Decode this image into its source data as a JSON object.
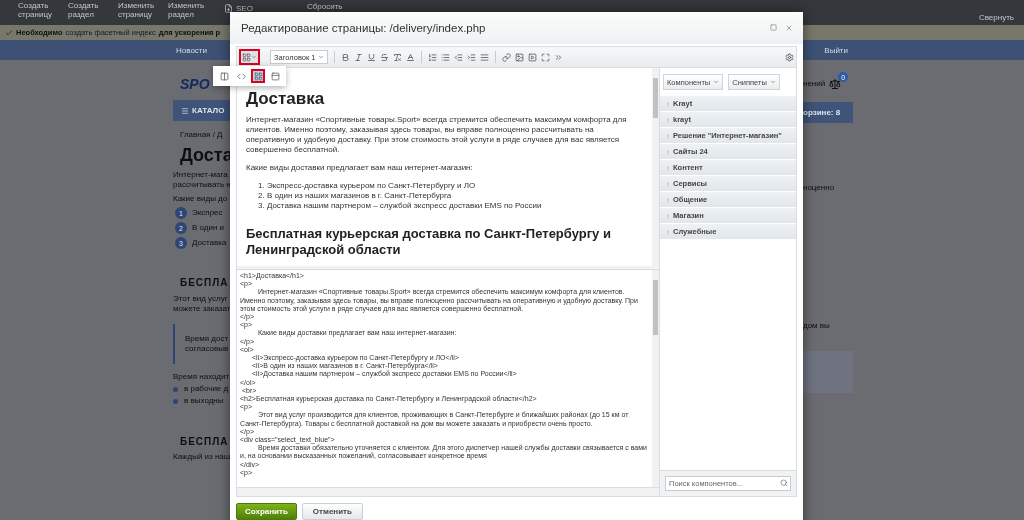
{
  "admin_bar": {
    "buttons": [
      "Создать страницу",
      "Создать раздел",
      "Изменить страницу",
      "Изменить раздел"
    ],
    "seo": "SEO",
    "reset": "Сбросить",
    "collapse": "Свернуть"
  },
  "notice": {
    "label": "Необходимо",
    "link": "создать фасетный индекс",
    "text": "для ускорения р"
  },
  "site_nav": {
    "item": "Новости",
    "logout": "Выйти"
  },
  "page_left": {
    "logo": "SPO",
    "catalog": "КАТАЛО",
    "breadcrumb": "Главная  /  Д",
    "title": "Доста",
    "intro": [
      "Интернет-мага",
      "рассчитывать н"
    ],
    "question": "Какие виды до",
    "steps": [
      {
        "number": "1",
        "text": "Экспрес"
      },
      {
        "number": "2",
        "text": "В один и"
      },
      {
        "number": "3",
        "text": "Доставка"
      }
    ],
    "heading": "БЕСПЛА",
    "para": [
      "Этот вид услуг",
      "можете заказат"
    ],
    "quote": [
      "Время дост",
      "согласовыв"
    ],
    "time": "Время находит",
    "bullets": [
      "в рабочие д",
      "в выходны"
    ],
    "heading2": "БЕСПЛА",
    "last": "Каждый из наш"
  },
  "page_right": {
    "compare": "нений",
    "compare_count": "0",
    "cart": "орзине: 8",
    "line1": "ноценно",
    "line2": "дом вы"
  },
  "dialog": {
    "title": "Редактирование страницы: /delivery/index.php",
    "mode_button": {
      "highlighted": true
    },
    "modes": [
      {
        "selected": false
      },
      {
        "selected": false
      },
      {
        "selected": true
      },
      {
        "selected": false
      }
    ],
    "style_select": "Заголовок 1",
    "visual": {
      "h1": "Доставка",
      "paragraphs": [
        "Интернет-магазин «Спортивные товары.Sport» всегда стремится обеспечить максимум комфорта для клиентов. Именно поэтому, заказывая здесь товары, вы вправе полноценно рассчитывать на оперативную и удобную доставку. При этом стоимость этой услуги в ряде случаев для вас является совершенно бесплатной.",
        "Какие виды доставки предлагает вам наш интернет-магазин:"
      ],
      "list": [
        {
          "number": "1.",
          "text": "Экспресс-доставка курьером по Санкт-Петербургу и ЛО"
        },
        {
          "number": "2.",
          "text": "В один из наших магазинов в г. Санкт-Петербурга"
        },
        {
          "number": "3.",
          "text": "Доставка нашим партнером – службой экспресс доставки EMS по России"
        }
      ],
      "h2": "Бесплатная курьерская доставка по Санкт-Петербургу и Ленинградской области"
    },
    "code": [
      {
        "kind": "tag",
        "text": "<h1>Доставка</h1>"
      },
      {
        "kind": "tag",
        "text": "<p>"
      },
      {
        "kind": "content",
        "text": "Интернет-магазин «Спортивные товары.Sport» всегда стремится обеспечить максимум комфорта для клиентов. Именно поэтому, заказывая здесь товары, вы вправе полноценно рассчитывать на оперативную и удобную доставку. При этом стоимость этой услуги в ряде случаев для вас является совершенно бесплатной."
      },
      {
        "kind": "tag",
        "text": "</p>"
      },
      {
        "kind": "tag",
        "text": "<p>"
      },
      {
        "kind": "content",
        "text": "Какие виды доставки предлагает вам наш интернет-магазин:"
      },
      {
        "kind": "tag",
        "text": "</p>"
      },
      {
        "kind": "tag",
        "text": "<ol>"
      },
      {
        "kind": "item",
        "text": "<li>Экспресс-доставка курьером по Санкт-Петербургу и ЛО</li>"
      },
      {
        "kind": "item",
        "text": "<li>В один из наших магазинов в г. Санкт-Петербурга</li>"
      },
      {
        "kind": "item",
        "text": "<li>Доставка нашим партнером – службой экспресс доставки EMS по России</li>"
      },
      {
        "kind": "tag",
        "text": "</ol>"
      },
      {
        "kind": "br",
        "text": "<br>"
      },
      {
        "kind": "tag",
        "text": "<h2>Бесплатная курьерская доставка по Санкт-Петербургу и Ленинградской области</h2>"
      },
      {
        "kind": "tag",
        "text": "<p>"
      },
      {
        "kind": "content",
        "text": "Этот вид услуг производится для клиентов, проживающих в Санкт-Петербурге и ближайших районах (до 15 км от Санкт-Петербурга). Товары с бесплатной доставкой на дом вы можете заказать и приобрести очень просто."
      },
      {
        "kind": "tag",
        "text": "</p>"
      },
      {
        "kind": "tag",
        "text": "<div class=\"select_text_blue\">"
      },
      {
        "kind": "content",
        "text": "Время доставки обязательно уточняется с клиентом. Для этого диспетчер нашей службы доставки связывается с вами и, на основании высказанных пожеланий, согласовывает конкретное время"
      },
      {
        "kind": "tag",
        "text": "</div>"
      },
      {
        "kind": "tag",
        "text": "<p>"
      }
    ],
    "panel_buttons": [
      "Компоненты",
      "Сниппеты"
    ],
    "groups": [
      "Krayt",
      "krayt",
      "Решение \"Интернет-магазин\"",
      "Сайты 24",
      "Контент",
      "Сервисы",
      "Общение",
      "Магазин",
      "Служебные"
    ],
    "search": {
      "placeholder": "Поиск компонентов..."
    },
    "save": "Сохранить",
    "cancel": "Отменить"
  }
}
